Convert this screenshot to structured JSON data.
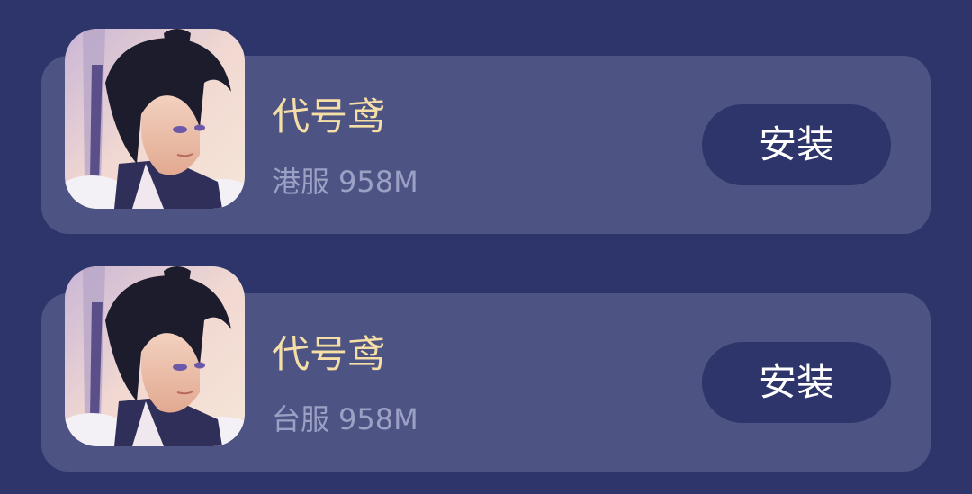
{
  "colors": {
    "background": "#2e356b",
    "card": "#4d5383",
    "title": "#f6dfa6",
    "meta": "#9ba0c4",
    "button_bg": "#2e356b",
    "button_text": "#ffffff"
  },
  "apps": [
    {
      "name": "代号鸢",
      "region": "港服",
      "size": "958M",
      "install_label": "安装",
      "icon": "game-character-icon"
    },
    {
      "name": "代号鸢",
      "region": "台服",
      "size": "958M",
      "install_label": "安装",
      "icon": "game-character-icon"
    }
  ]
}
